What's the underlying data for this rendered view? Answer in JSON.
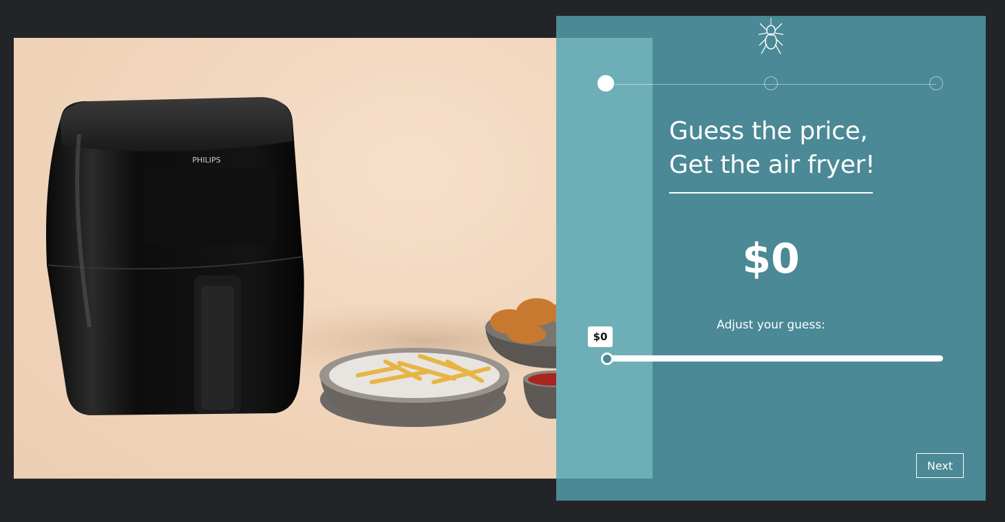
{
  "brand": {
    "logo_icon": "spider-icon"
  },
  "product_image": {
    "brand_label": "PHILIPS"
  },
  "progress": {
    "total_steps": 3,
    "current_step": 1
  },
  "quiz": {
    "headline_line1": "Guess the price,",
    "headline_line2": "Get the air fryer!",
    "price_display": "$0",
    "adjust_label": "Adjust your guess:",
    "slider_tooltip": "$0",
    "slider_value": 0
  },
  "actions": {
    "next_label": "Next"
  },
  "colors": {
    "panel": "#4a8995",
    "panel_overlay": "#8ccdd4",
    "page_background": "#232427",
    "accent": "#ffffff"
  }
}
